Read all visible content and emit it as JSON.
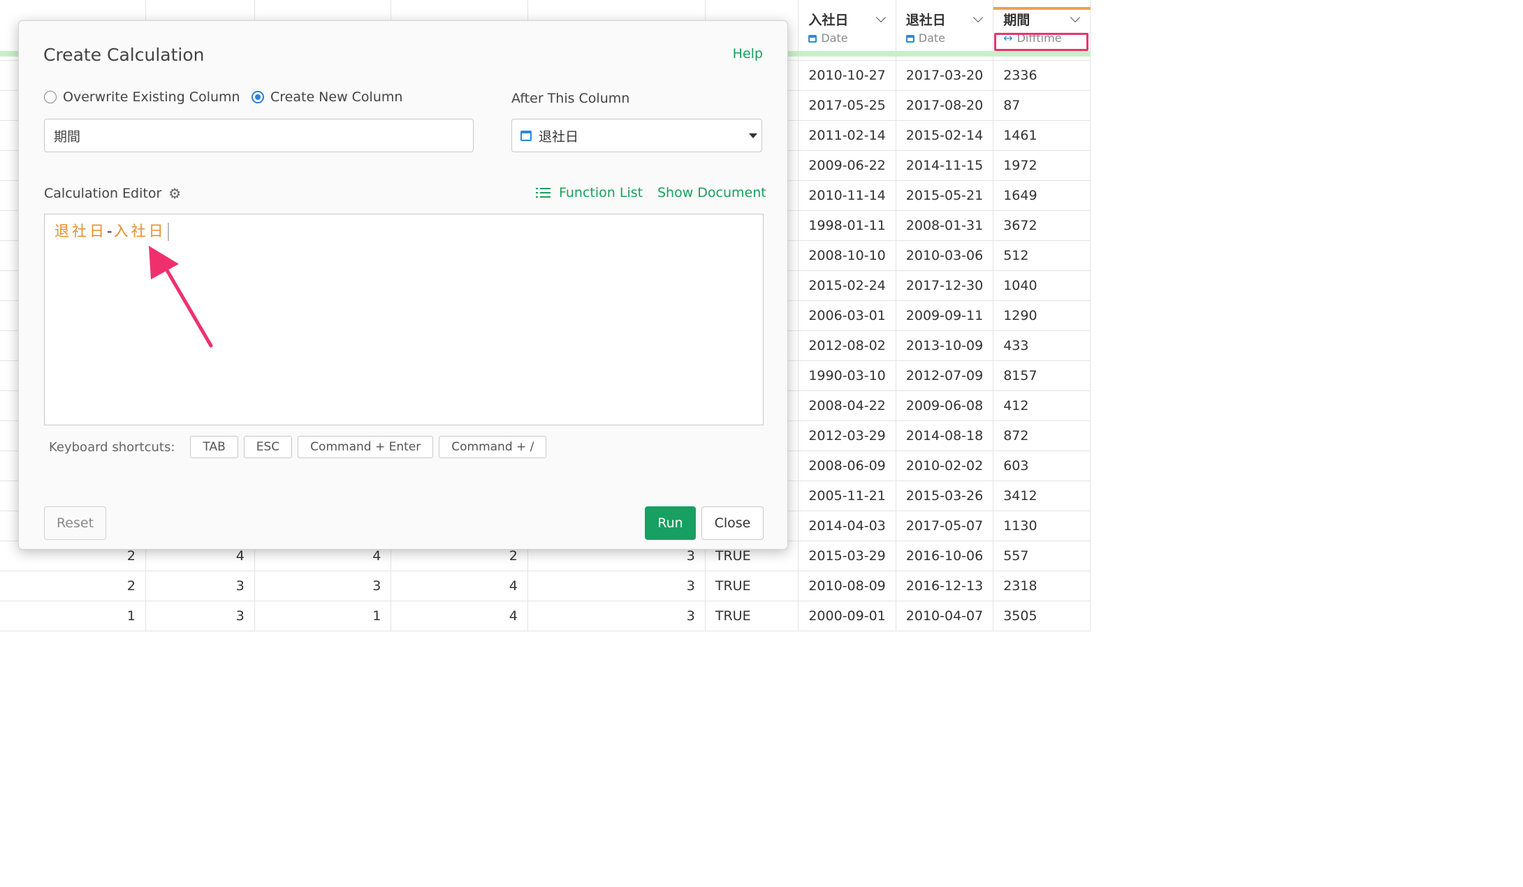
{
  "table": {
    "columns": [
      {
        "name": "",
        "type": "",
        "icon": "",
        "width": 210
      },
      {
        "name": "",
        "type": "",
        "icon": "",
        "width": 157
      },
      {
        "name": "",
        "type": "",
        "icon": "",
        "width": 197
      },
      {
        "name": "",
        "type": "",
        "icon": "",
        "width": 197
      },
      {
        "name": "",
        "type": "",
        "icon": "",
        "width": 256
      },
      {
        "name": "",
        "type": "",
        "icon": "",
        "width": 134
      },
      {
        "name": "入社日",
        "type": "Date",
        "icon": "calendar-icon",
        "width": 135
      },
      {
        "name": "退社日",
        "type": "Date",
        "icon": "calendar-icon",
        "width": 136
      },
      {
        "name": "期間",
        "type": "Difftime",
        "icon": "double-arrow-icon",
        "width": 139
      }
    ],
    "rows": [
      [
        "",
        "",
        "",
        "",
        "",
        "",
        "2010-10-27",
        "2017-03-20",
        "2336"
      ],
      [
        "",
        "",
        "",
        "",
        "",
        "",
        "2017-05-25",
        "2017-08-20",
        "87"
      ],
      [
        "",
        "",
        "",
        "",
        "",
        "",
        "2011-02-14",
        "2015-02-14",
        "1461"
      ],
      [
        "",
        "",
        "",
        "",
        "",
        "",
        "2009-06-22",
        "2014-11-15",
        "1972"
      ],
      [
        "",
        "",
        "",
        "",
        "",
        "",
        "2010-11-14",
        "2015-05-21",
        "1649"
      ],
      [
        "",
        "",
        "",
        "",
        "",
        "",
        "1998-01-11",
        "2008-01-31",
        "3672"
      ],
      [
        "",
        "",
        "",
        "",
        "",
        "",
        "2008-10-10",
        "2010-03-06",
        "512"
      ],
      [
        "",
        "",
        "",
        "",
        "",
        "",
        "2015-02-24",
        "2017-12-30",
        "1040"
      ],
      [
        "",
        "",
        "",
        "",
        "",
        "",
        "2006-03-01",
        "2009-09-11",
        "1290"
      ],
      [
        "",
        "",
        "",
        "",
        "",
        "",
        "2012-08-02",
        "2013-10-09",
        "433"
      ],
      [
        "",
        "",
        "",
        "",
        "",
        "",
        "1990-03-10",
        "2012-07-09",
        "8157"
      ],
      [
        "",
        "",
        "",
        "",
        "",
        "",
        "2008-04-22",
        "2009-06-08",
        "412"
      ],
      [
        "",
        "",
        "",
        "",
        "",
        "",
        "2012-03-29",
        "2014-08-18",
        "872"
      ],
      [
        "",
        "",
        "",
        "",
        "",
        "",
        "2008-06-09",
        "2010-02-02",
        "603"
      ],
      [
        "",
        "",
        "",
        "",
        "",
        "",
        "2005-11-21",
        "2015-03-26",
        "3412"
      ],
      [
        "",
        "",
        "",
        "",
        "",
        "",
        "2014-04-03",
        "2017-05-07",
        "1130"
      ],
      [
        "2",
        "4",
        "4",
        "2",
        "3",
        "TRUE",
        "2015-03-29",
        "2016-10-06",
        "557"
      ],
      [
        "2",
        "3",
        "3",
        "4",
        "3",
        "TRUE",
        "2010-08-09",
        "2016-12-13",
        "2318"
      ],
      [
        "1",
        "3",
        "1",
        "4",
        "3",
        "TRUE",
        "2000-09-01",
        "2010-04-07",
        "3505"
      ]
    ],
    "numeric_columns": [
      0,
      1,
      2,
      3,
      4
    ]
  },
  "dialog": {
    "title": "Create Calculation",
    "help": "Help",
    "radio_overwrite": "Overwrite Existing Column",
    "radio_create": "Create New Column",
    "after_label": "After This Column",
    "name_value": "期間",
    "after_value": "退社日",
    "editor_label": "Calculation Editor",
    "function_list": "Function List",
    "show_document": "Show Document",
    "expr_left": "退社日",
    "expr_op": "-",
    "expr_right": "入社日",
    "shortcuts_label": "Keyboard shortcuts:",
    "shortcuts": [
      "TAB",
      "ESC",
      "Command + Enter",
      "Command + /"
    ],
    "reset": "Reset",
    "run": "Run",
    "close": "Close"
  },
  "colors": {
    "accent_green": "#17a061",
    "highlight_pink": "#e8356f",
    "formula_orange": "#e58e2a",
    "type_blue": "#2b8ad8"
  }
}
